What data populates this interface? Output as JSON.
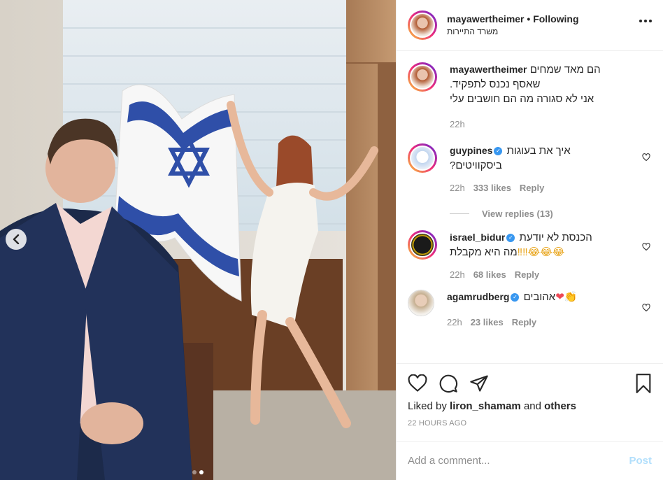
{
  "header": {
    "username": "mayawertheimer",
    "separator": "•",
    "follow_state": "Following",
    "location": "משרד התיירות"
  },
  "caption": {
    "username": "mayawertheimer",
    "line1": "הם מאד שמחים",
    "line2": "שאסף נכנס לתפקיד.",
    "line3": "אני לא סגורה מה הם חושבים עלי",
    "time": "22h"
  },
  "comments": [
    {
      "username": "guypines",
      "text1": "איך את בעוגות",
      "text2": "ביסקוויטים?",
      "time": "22h",
      "likes": "333 likes",
      "reply_label": "Reply",
      "view_replies": "View replies (13)"
    },
    {
      "username": "israel_bidur",
      "text1": "הכנסת לא יודעת",
      "text2": "מה היא מקבלת",
      "emojis": "‼‼😂😂😂",
      "time": "22h",
      "likes": "68 likes",
      "reply_label": "Reply"
    },
    {
      "username": "agamrudberg",
      "text1": "אהובים",
      "emojis": "❤👏",
      "time": "22h",
      "likes": "23 likes",
      "reply_label": "Reply"
    }
  ],
  "likes_summary": {
    "prefix": "Liked by",
    "user": "liron_shamam",
    "joiner": "and",
    "others": "others"
  },
  "timestamp": "22 HOURS AGO",
  "add_comment": {
    "placeholder": "Add a comment...",
    "post_label": "Post"
  },
  "colors": {
    "verified": "#3897f0",
    "post_disabled": "#b2dffc",
    "heart_red": "#ed4956",
    "flag_blue": "#2f4fa8"
  },
  "icons": [
    "heart-icon",
    "comment-icon",
    "share-icon",
    "bookmark-icon",
    "more-icon",
    "chevron-left-icon",
    "verified-icon"
  ]
}
